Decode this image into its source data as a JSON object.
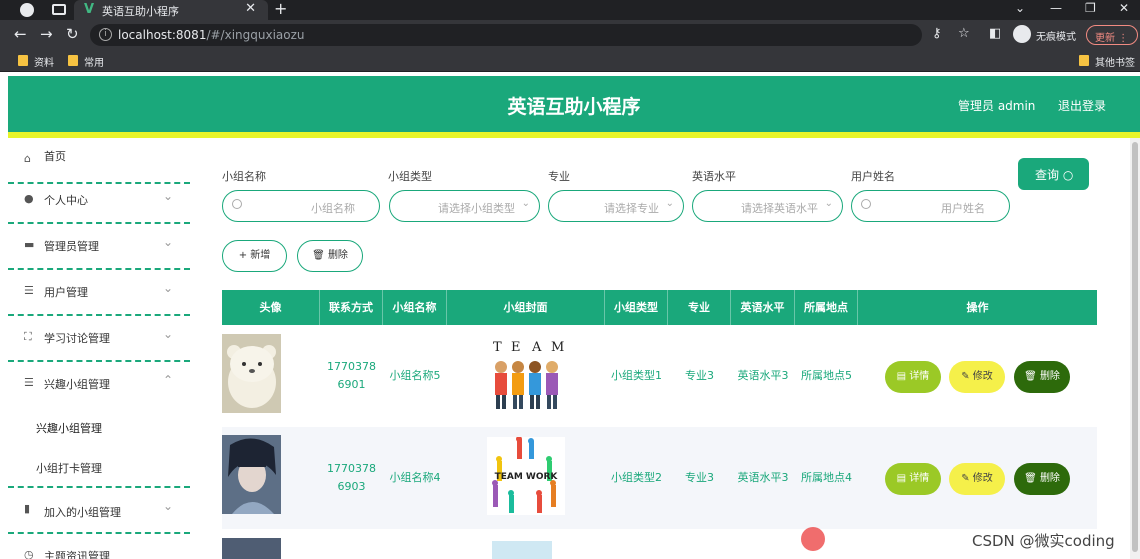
{
  "browser": {
    "tab_title": "英语互助小程序",
    "url_host": "localhost:8081",
    "url_path": "/#/xingquxiaozu",
    "incognito_label": "无痕模式",
    "update_label": "更新",
    "bookmarks": [
      "资料",
      "常用"
    ],
    "other_bookmarks": "其他书签"
  },
  "header": {
    "title": "英语互助小程序",
    "admin": "管理员 admin",
    "logout": "退出登录"
  },
  "sidebar": {
    "items": [
      {
        "label": "首页",
        "icon": "home-icon"
      },
      {
        "label": "个人中心",
        "icon": "user-icon"
      },
      {
        "label": "管理员管理",
        "icon": "admin-icon"
      },
      {
        "label": "用户管理",
        "icon": "list-icon"
      },
      {
        "label": "学习讨论管理",
        "icon": "frame-icon"
      },
      {
        "label": "兴趣小组管理",
        "icon": "list-icon"
      },
      {
        "label": "加入的小组管理",
        "icon": "chart-icon"
      },
      {
        "label": "主题资讯管理",
        "icon": "clock-icon"
      }
    ],
    "subitems": [
      "兴趣小组管理",
      "小组打卡管理"
    ]
  },
  "filters": {
    "labels": [
      "小组名称",
      "小组类型",
      "专业",
      "英语水平",
      "用户姓名"
    ],
    "placeholders": [
      "小组名称",
      "请选择小组类型",
      "请选择专业",
      "请选择英语水平",
      "用户姓名"
    ],
    "query": "查询",
    "add": "新增",
    "delete": "删除"
  },
  "table": {
    "headers": [
      "头像",
      "联系方式",
      "小组名称",
      "小组封面",
      "小组类型",
      "专业",
      "英语水平",
      "所属地点",
      "操作"
    ],
    "rows": [
      {
        "phone": "17703786901",
        "group_name": "小组名称5",
        "group_type": "小组类型1",
        "major": "专业3",
        "level": "英语水平3",
        "location": "所属地点5"
      },
      {
        "phone": "17703786903",
        "group_name": "小组名称4",
        "group_type": "小组类型2",
        "major": "专业3",
        "level": "英语水平3",
        "location": "所属地点4"
      }
    ],
    "actions": {
      "detail": "详情",
      "edit": "修改",
      "delete": "删除"
    },
    "cover_text": [
      "T",
      "E",
      "A",
      "M"
    ],
    "cover_text2": "TEAM WORK"
  },
  "watermark": "CSDN @微实coding",
  "colors": {
    "primary": "#1aa87b",
    "accent_bar": "#e8f52a",
    "detail_btn": "#9bc926",
    "edit_btn": "#f5f04a",
    "delete_btn": "#2d6a0b"
  }
}
